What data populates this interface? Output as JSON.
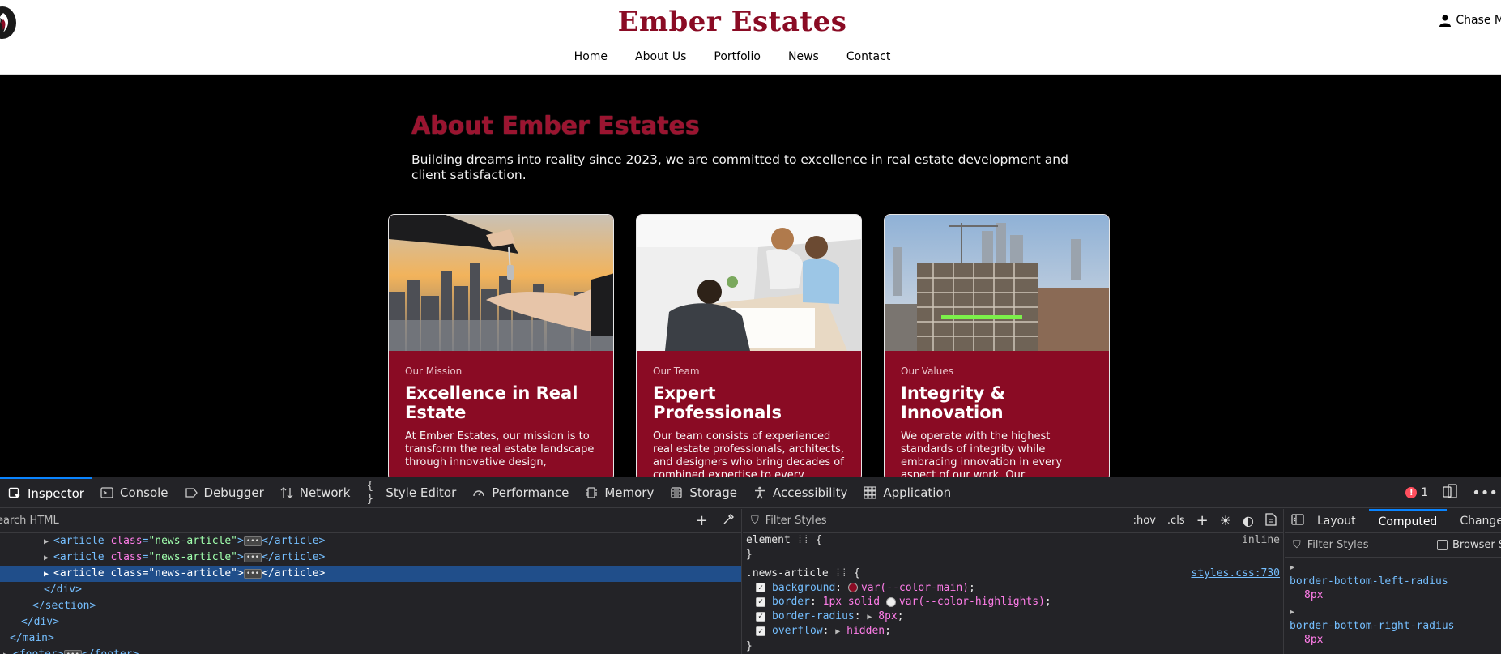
{
  "site": {
    "brand": "Ember Estates",
    "user_name": "Chase M",
    "nav": [
      "Home",
      "About Us",
      "Portfolio",
      "News",
      "Contact"
    ]
  },
  "about": {
    "title": "About Ember Estates",
    "subtitle": "Building dreams into reality since 2023, we are committed to excellence in real estate development and client satisfaction."
  },
  "cards": [
    {
      "kicker": "Our Mission",
      "title": "Excellence in Real Estate",
      "text": "At Ember Estates, our mission is to transform the real estate landscape through innovative design,"
    },
    {
      "kicker": "Our Team",
      "title": "Expert Professionals",
      "text": "Our team consists of experienced real estate professionals, architects, and designers who bring decades of combined expertise to every project. We pride ourselves on our"
    },
    {
      "kicker": "Our Values",
      "title": "Integrity & Innovation",
      "text": "We operate with the highest standards of integrity while embracing innovation in every aspect of our work. Our commitment to sustainability and"
    }
  ],
  "devtools": {
    "tabs": [
      {
        "label": "Inspector",
        "icon": "inspector-icon"
      },
      {
        "label": "Console",
        "icon": "console-icon"
      },
      {
        "label": "Debugger",
        "icon": "debugger-icon"
      },
      {
        "label": "Network",
        "icon": "network-icon"
      },
      {
        "label": "Style Editor",
        "icon": "style-editor-icon"
      },
      {
        "label": "Performance",
        "icon": "performance-icon"
      },
      {
        "label": "Memory",
        "icon": "memory-icon"
      },
      {
        "label": "Storage",
        "icon": "storage-icon"
      },
      {
        "label": "Accessibility",
        "icon": "accessibility-icon"
      },
      {
        "label": "Application",
        "icon": "application-icon"
      }
    ],
    "error_count": "1",
    "search_placeholder": "earch HTML",
    "rules_filter_placeholder": "Filter Styles",
    "hov": ":hov",
    "cls": ".cls",
    "element_selector": "element",
    "inline_label": "inline",
    "rule_selector": ".news-article",
    "rule_source": "styles.css:730",
    "declarations": [
      {
        "prop": "background",
        "value": "var(--color-main)",
        "swatch": "#8a0b24"
      },
      {
        "prop": "border",
        "value_prefix": "1px solid",
        "value": "var(--color-highlights)",
        "swatch": "#eeeeee"
      },
      {
        "prop": "border-radius",
        "value": "8px",
        "expandable": true
      },
      {
        "prop": "overflow",
        "value": "hidden",
        "expandable": true
      }
    ],
    "computed_tabs": [
      "Layout",
      "Computed",
      "Changes"
    ],
    "computed_filter_placeholder": "Filter Styles",
    "browser_styles_label": "Browser Styles",
    "computed": [
      {
        "name": "border-bottom-left-radius",
        "value": "8px"
      },
      {
        "name": "border-bottom-right-radius",
        "value": "8px"
      }
    ]
  }
}
